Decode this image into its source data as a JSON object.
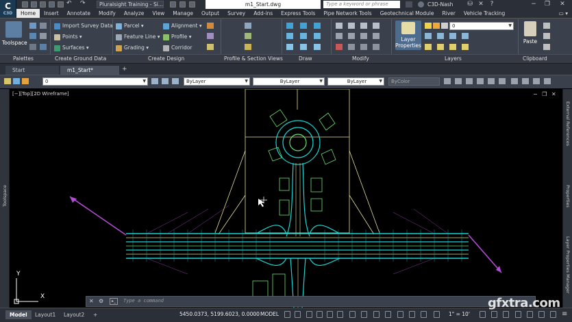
{
  "app": {
    "logo": "C",
    "logo_sub": "C3D"
  },
  "titlebar": {
    "workspace": "Pluralsight Training - Si...",
    "file_title": "m1_Start.dwg",
    "search_placeholder": "Type a keyword or phrase",
    "user": "C3D-Nash"
  },
  "ribbon_tabs": [
    {
      "label": "Home",
      "active": true
    },
    {
      "label": "Insert"
    },
    {
      "label": "Annotate"
    },
    {
      "label": "Modify"
    },
    {
      "label": "Analyze"
    },
    {
      "label": "View"
    },
    {
      "label": "Manage"
    },
    {
      "label": "Output"
    },
    {
      "label": "Survey"
    },
    {
      "label": "Add-ins"
    },
    {
      "label": "Express Tools"
    },
    {
      "label": "Pipe Network Tools"
    },
    {
      "label": "Geotechnical Module"
    },
    {
      "label": "River"
    },
    {
      "label": "Vehicle Tracking"
    }
  ],
  "ribbon": {
    "toolspace": "Toolspace",
    "import_survey": "Import Survey Data",
    "points": "Points",
    "surfaces": "Surfaces",
    "parcel": "Parcel",
    "feature_line": "Feature Line",
    "grading": "Grading",
    "alignment": "Alignment",
    "profile": "Profile",
    "corridor": "Corridor",
    "layer_properties": "Layer Properties",
    "layer_value": "0",
    "paste": "Paste"
  },
  "panel_titles": {
    "palettes": "Palettes",
    "create_ground_data": "Create Ground Data",
    "create_design": "Create Design",
    "profile_section_views": "Profile & Section Views",
    "draw": "Draw",
    "modify": "Modify",
    "layers": "Layers",
    "clipboard": "Clipboard"
  },
  "doc_tabs": [
    {
      "label": "Start",
      "active": false
    },
    {
      "label": "m1_Start*",
      "active": true
    }
  ],
  "propbar": {
    "layer": "0",
    "color": "ByLayer",
    "linetype": "ByLayer",
    "lineweight": "ByLayer",
    "plotstyle": "ByColor"
  },
  "viewport": {
    "label": "[−][Top][2D Wireframe]"
  },
  "palettes": {
    "left": "Toolspace",
    "right_1": "External References",
    "right_2": "Properties",
    "right_3": "Layer Properties Manager"
  },
  "cmdline": {
    "placeholder": "Type a command"
  },
  "layout_tabs": [
    {
      "label": "Model",
      "active": true
    },
    {
      "label": "Layout1"
    },
    {
      "label": "Layout2"
    },
    {
      "label": "+"
    }
  ],
  "status": {
    "coords": "5450.0373, 5199.6023, 0.0000",
    "model": "MODEL",
    "scale": "1\" = 10'"
  },
  "ucs": {
    "x_label": "X",
    "y_label": "Y"
  },
  "watermark": "gfxtra.com",
  "colors": {
    "accent": "#2b8fd6",
    "cad_cyan": "#19d6d6",
    "cad_green": "#6fe06f",
    "cad_yellow": "#e8e29a",
    "cad_magenta": "#b64bd6"
  }
}
